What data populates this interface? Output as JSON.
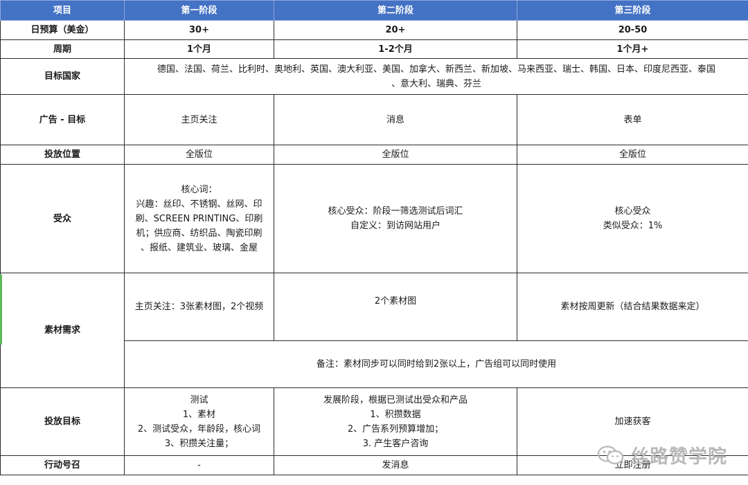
{
  "header": {
    "col0": "项目",
    "col1": "第一阶段",
    "col2": "第二阶段",
    "col3": "第三阶段"
  },
  "rows": {
    "budget": {
      "label": "日预算（美金）",
      "s1": "30+",
      "s2": "20+",
      "s3": "20-50"
    },
    "period": {
      "label": "周期",
      "s1": "1个月",
      "s2": "1-2个月",
      "s3": "1个月+"
    },
    "countries": {
      "label": "目标国家",
      "line1": "德国、法国、荷兰、比利时、奥地利、英国、澳大利亚、美国、加拿大、新西兰、新加坡、马来西亚、瑞士、韩国、日本、印度尼西亚、泰国",
      "line2": "、意大利、瑞典、芬兰"
    },
    "ad_goal": {
      "label": "广告 - 目标",
      "s1": "主页关注",
      "s2": "消息",
      "s3": "表单"
    },
    "placement": {
      "label": "投放位置",
      "s1": "全版位",
      "s2": "全版位",
      "s3": "全版位"
    },
    "audience": {
      "label": "受众",
      "s1": [
        "核心词：",
        "兴趣：丝印、不锈钢、丝网、印",
        "刷、SCREEN PRINTING、印刷",
        "机；供应商、纺织品、陶瓷印刷",
        "、报纸、建筑业、玻璃、金屋"
      ],
      "s2": [
        "核心受众：阶段一筛选测试后词汇",
        "自定义：到访网站用户"
      ],
      "s3": [
        "核心受众",
        "类似受众：1%"
      ]
    },
    "material": {
      "label": "素材需求",
      "s1": "主页关注：3张素材图，2个视频",
      "s2": "2个素材图",
      "s3": "素材按周更新（结合结果数据来定）",
      "note": "备注：素材同步可以同时给到2张以上，广告组可以同时使用"
    },
    "target": {
      "label": "投放目标",
      "s1": [
        "测试",
        "1、素材",
        "2、测试受众，年龄段，核心词",
        "3、积攒关注量；"
      ],
      "s2": [
        "发展阶段，根据已测试出受众和产品",
        "1、积攒数据",
        "2、广告系列预算增加；",
        "3. 产生客户咨询"
      ],
      "s3": "加速获客"
    },
    "cta": {
      "label": "行动号召",
      "s1": "-",
      "s2": "发消息",
      "s3": "立即注册"
    }
  },
  "watermark": {
    "text": "丝路赞学院",
    "icon": "wechat-icon"
  },
  "colors": {
    "header_bg": "#4472c4",
    "header_text": "#ffffff",
    "watermark": "#b8b8b8"
  }
}
